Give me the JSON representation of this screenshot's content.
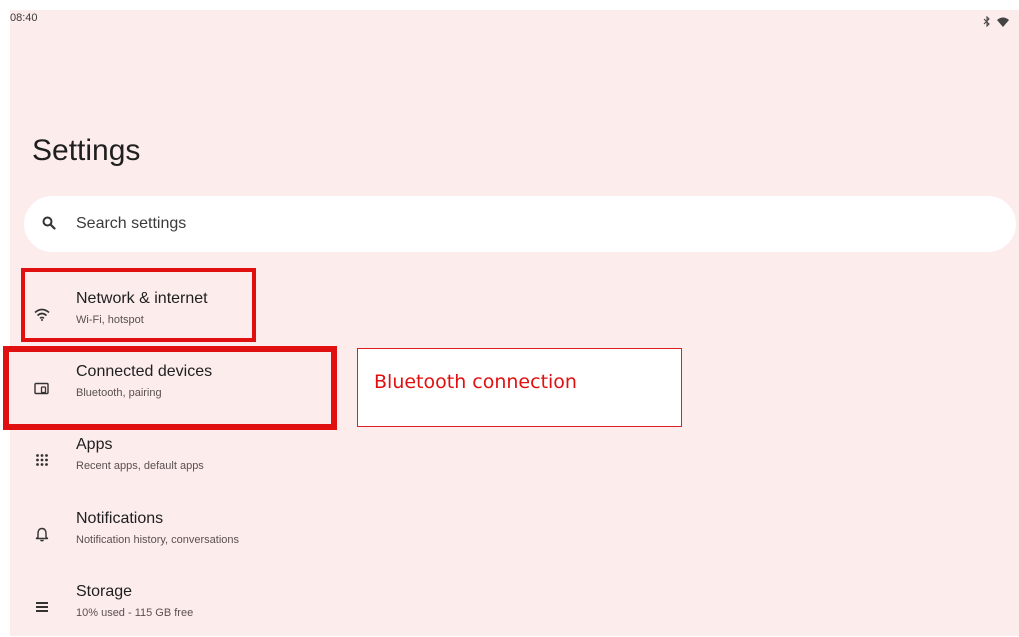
{
  "status_bar": {
    "time": "08:40",
    "icons": [
      "bluetooth-icon",
      "wifi-icon"
    ]
  },
  "header": {
    "title": "Settings"
  },
  "search": {
    "placeholder": "Search settings",
    "icon": "search-icon"
  },
  "items": [
    {
      "title": "Network & internet",
      "subtitle": "Wi-Fi, hotspot",
      "icon": "wifi-icon"
    },
    {
      "title": "Connected devices",
      "subtitle": "Bluetooth, pairing",
      "icon": "connected-devices-icon"
    },
    {
      "title": "Apps",
      "subtitle": "Recent apps, default apps",
      "icon": "apps-grid-icon"
    },
    {
      "title": "Notifications",
      "subtitle": "Notification history, conversations",
      "icon": "bell-icon"
    },
    {
      "title": "Storage",
      "subtitle": "10% used - 115 GB free",
      "icon": "storage-icon"
    }
  ],
  "annotation": {
    "callout_text": "Bluetooth connection",
    "color": "#e01010"
  },
  "colors": {
    "screen_background": "#fcecec",
    "search_background": "#ffffff"
  }
}
